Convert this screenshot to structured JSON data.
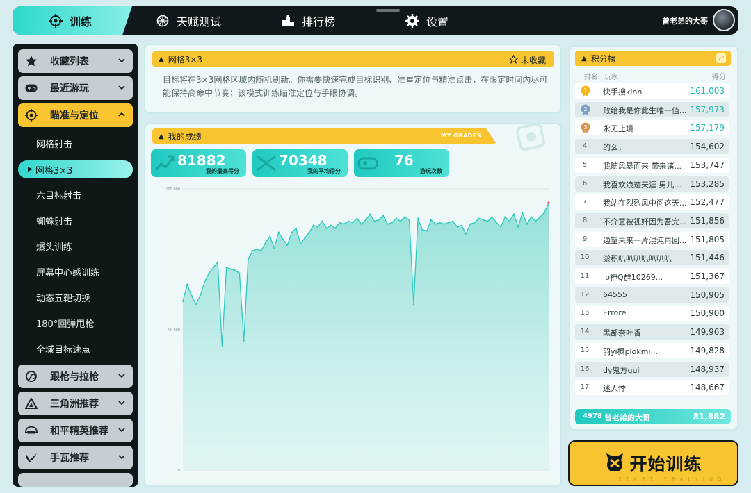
{
  "nav": {
    "tabs": [
      {
        "label": "训练",
        "icon": "crosshair-icon"
      },
      {
        "label": "天赋测试",
        "icon": "radar-icon"
      },
      {
        "label": "排行榜",
        "icon": "podium-icon"
      },
      {
        "label": "设置",
        "icon": "gear-icon"
      }
    ],
    "user_name": "曾老弟的大哥"
  },
  "sidebar": {
    "categories_top": [
      {
        "label": "收藏列表",
        "icon": "star-icon"
      },
      {
        "label": "最近游玩",
        "icon": "gamepad-icon"
      }
    ],
    "open_category": {
      "label": "瞄准与定位",
      "icon": "target-icon"
    },
    "sub_items": [
      "网格射击",
      "网格3×3",
      "六目标射击",
      "蜘蛛射击",
      "爆头训练",
      "屏幕中心感训练",
      "动态五靶切换",
      "180°回弹甩枪",
      "全域目标速点"
    ],
    "categories_bottom": [
      {
        "label": "跟枪与拉枪",
        "icon": "tracking-icon"
      },
      {
        "label": "三角洲推荐",
        "icon": "delta-icon"
      },
      {
        "label": "和平精英推荐",
        "icon": "helmet-icon"
      },
      {
        "label": "手瓦推荐",
        "icon": "valorant-icon"
      }
    ]
  },
  "mode": {
    "title": "网格3×3",
    "favorite_label": "未收藏",
    "description": "目标将在3×3网格区域内随机刷新。你需要快速完成目标识别、准星定位与精准点击，在限定时间内尽可能保持高命中节奏；该模式训练瞄准定位与手眼协调。"
  },
  "grades": {
    "title": "我的成绩",
    "title_en": "MY GRADES",
    "stats": [
      {
        "value": "81882",
        "label": "我的最高得分"
      },
      {
        "value": "70348",
        "label": "我的平均得分"
      },
      {
        "value": "76",
        "label": "游玩次数"
      }
    ]
  },
  "chart_data": {
    "type": "area",
    "ylim": [
      0,
      100000
    ],
    "yticks": [
      "100,000",
      "50,000",
      "0"
    ],
    "grid": true,
    "color": "#2fc9c0",
    "values": [
      60000,
      66000,
      62000,
      59000,
      62000,
      67000,
      70000,
      72000,
      74000,
      44000,
      72000,
      71500,
      71000,
      70000,
      46000,
      75000,
      78000,
      78500,
      78000,
      81000,
      83000,
      79000,
      84500,
      82000,
      80000,
      84500,
      86000,
      80500,
      82500,
      84500,
      87000,
      86500,
      88500,
      86000,
      87000,
      86000,
      88000,
      87500,
      88500,
      88000,
      89500,
      87500,
      89000,
      91000,
      88500,
      89000,
      90500,
      87500,
      88000,
      89500,
      88500,
      90000,
      89000,
      59000,
      89500,
      85500,
      85000,
      89000,
      87500,
      88000,
      87500,
      88000,
      88500,
      86500,
      87000,
      84000,
      87500,
      88000,
      89500,
      89000,
      88500,
      90000,
      88000,
      86500,
      90000,
      88500,
      91000,
      86500,
      91500,
      87500,
      90000,
      88500,
      90000,
      91500,
      95000
    ]
  },
  "leaderboard": {
    "title": "积分榜",
    "headers": {
      "rank": "排名",
      "player": "玩家",
      "score": "得分"
    },
    "rows": [
      {
        "rank": "1",
        "name": "快手搜kinn",
        "score": "161,003"
      },
      {
        "rank": "2",
        "name": "败给我是你此生唯一值...",
        "score": "157,973"
      },
      {
        "rank": "3",
        "name": "永无止境",
        "score": "157,179"
      },
      {
        "rank": "4",
        "name": "的么，",
        "score": "154,602"
      },
      {
        "rank": "5",
        "name": "我随风暴而来 带来诸...",
        "score": "153,747"
      },
      {
        "rank": "6",
        "name": "我喜欢浪迹天涯 男儿...",
        "score": "153,285"
      },
      {
        "rank": "7",
        "name": "我站在烈烈风中问这天...",
        "score": "152,477"
      },
      {
        "rank": "8",
        "name": "不介意被视奸因为吾完...",
        "score": "151,856"
      },
      {
        "rank": "9",
        "name": "通望未来一片混沌再回...",
        "score": "151,805"
      },
      {
        "rank": "10",
        "name": "淤积叭叭叭叭叭叭叭",
        "score": "151,446"
      },
      {
        "rank": "11",
        "name": "jb神Q群10269...",
        "score": "151,367"
      },
      {
        "rank": "12",
        "name": "64555",
        "score": "150,905"
      },
      {
        "rank": "13",
        "name": "Errore",
        "score": "150,900"
      },
      {
        "rank": "14",
        "name": "黑部奈叶香",
        "score": "149,963"
      },
      {
        "rank": "15",
        "name": "羽yi枫plokmi...",
        "score": "149,828"
      },
      {
        "rank": "16",
        "name": "dy鬼方gui",
        "score": "148,937"
      },
      {
        "rank": "17",
        "name": "迷人悸",
        "score": "148,667"
      }
    ],
    "me": {
      "rank": "4978",
      "name": "曾老弟的大哥",
      "score": "81,882"
    }
  },
  "start_button": {
    "label": "开始训练",
    "label_en": "START TRAINING"
  }
}
